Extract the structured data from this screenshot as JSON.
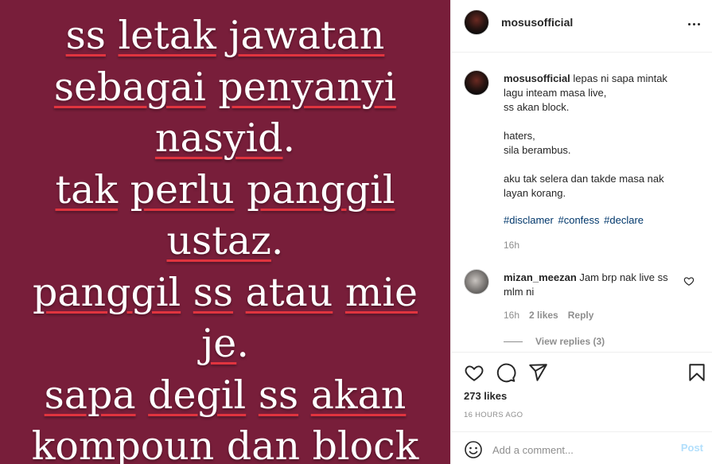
{
  "post_image": {
    "background_color": "#781e3a",
    "underline_color": "#e0343f",
    "lines": [
      [
        {
          "t": "ss",
          "u": true
        },
        {
          "t": " "
        },
        {
          "t": "letak",
          "u": true
        },
        {
          "t": " "
        },
        {
          "t": "jawatan",
          "u": true
        }
      ],
      [
        {
          "t": "sebagai",
          "u": true
        },
        {
          "t": " "
        },
        {
          "t": "penyanyi",
          "u": true
        }
      ],
      [
        {
          "t": "nasyid",
          "u": true
        },
        {
          "t": "."
        }
      ],
      [
        {
          "t": "tak",
          "u": true
        },
        {
          "t": " "
        },
        {
          "t": "perlu",
          "u": true
        },
        {
          "t": " "
        },
        {
          "t": "panggil",
          "u": true
        }
      ],
      [
        {
          "t": "ustaz",
          "u": true
        },
        {
          "t": "."
        }
      ],
      [
        {
          "t": "panggil",
          "u": true
        },
        {
          "t": " "
        },
        {
          "t": "ss",
          "u": true
        },
        {
          "t": " "
        },
        {
          "t": "atau",
          "u": true
        },
        {
          "t": " "
        },
        {
          "t": "mie",
          "u": true
        }
      ],
      [
        {
          "t": "je",
          "u": true
        },
        {
          "t": "."
        }
      ],
      [
        {
          "t": "sapa",
          "u": true
        },
        {
          "t": " "
        },
        {
          "t": "degil",
          "u": true
        },
        {
          "t": " "
        },
        {
          "t": "ss",
          "u": true
        },
        {
          "t": " "
        },
        {
          "t": "akan",
          "u": true
        }
      ],
      [
        {
          "t": "kompoun",
          "u": true
        },
        {
          "t": " dan block"
        }
      ]
    ]
  },
  "header": {
    "username": "mosusofficial",
    "avatar_icon": "profile-avatar",
    "more_icon": "more-options-icon"
  },
  "caption": {
    "username": "mosusofficial",
    "text": " lepas ni sapa mintak\nlagu inteam masa live,\nss akan block.\n\nhaters,\nsila berambus.\n\naku tak selera dan takde masa nak\nlayan korang.",
    "hashtags": [
      "#disclamer",
      "#confess",
      "#declare"
    ],
    "time": "16h"
  },
  "comment": {
    "username": "mizan_meezan",
    "text": " Jam brp nak live ss mlm ni",
    "time": "16h",
    "likes": "2 likes",
    "reply": "Reply",
    "view_replies": "View replies (3)"
  },
  "actions": {
    "icons": [
      "heart-icon",
      "comment-icon",
      "share-icon",
      "bookmark-icon"
    ],
    "likes": "273 likes",
    "timestamp": "16 HOURS AGO"
  },
  "add_comment": {
    "placeholder": "Add a comment...",
    "post_label": "Post",
    "post_color": "#b2dffc"
  }
}
